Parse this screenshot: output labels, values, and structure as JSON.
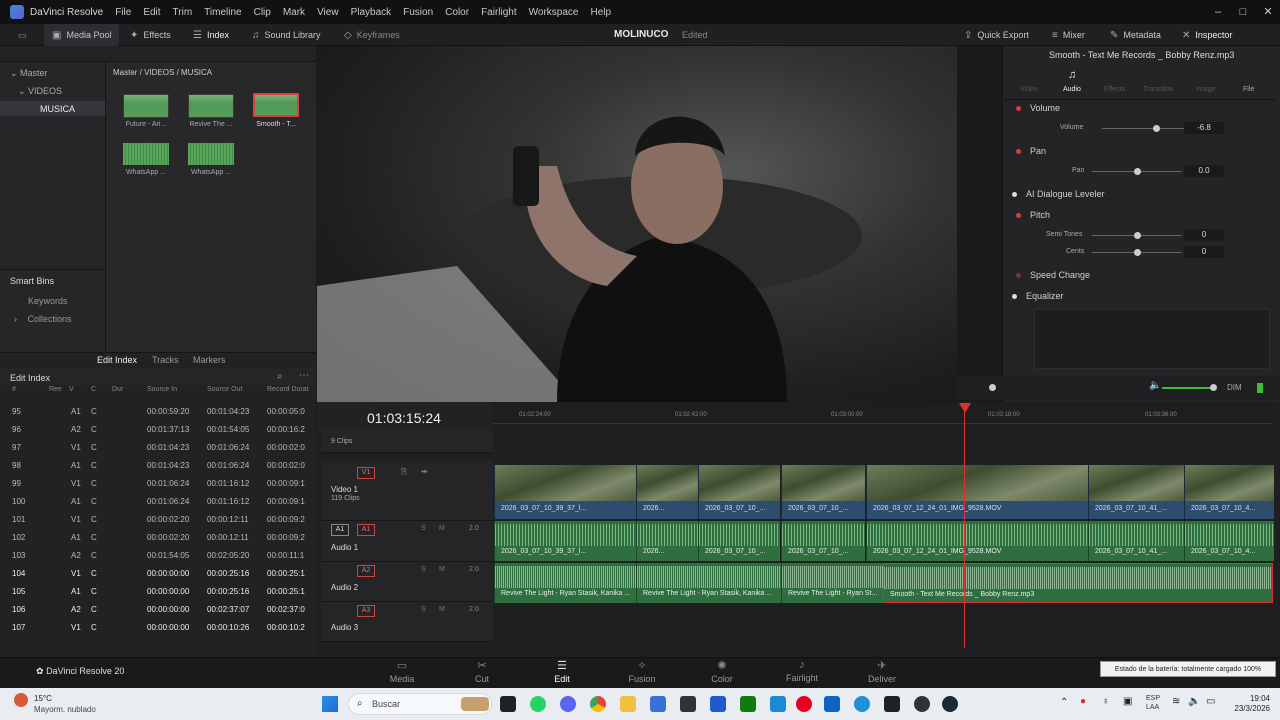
{
  "titlebar": {
    "app": "DaVinci Resolve",
    "menus": [
      "File",
      "Edit",
      "Trim",
      "Timeline",
      "Clip",
      "Mark",
      "View",
      "Playback",
      "Fusion",
      "Color",
      "Fairlight",
      "Workspace",
      "Help"
    ]
  },
  "toolbar": {
    "media_pool": "Media Pool",
    "effects": "Effects",
    "index": "Index",
    "sound_library": "Sound Library",
    "keyframes": "Keyframes",
    "project": "MOLINUCO",
    "status": "Edited",
    "quick_export": "Quick Export",
    "mixer": "Mixer",
    "metadata": "Metadata",
    "inspector": "Inspector"
  },
  "media": {
    "root": "Master",
    "videos": "VIDEOS",
    "musica": "MUSICA",
    "breadcrumb": "Master / VIDEOS / MUSICA",
    "smart_bins": "Smart Bins",
    "keywords": "Keywords",
    "collections": "Collections",
    "clips": [
      "Future - Ari...",
      "Revive The ...",
      "Smooth - T...",
      "WhatsApp ...",
      "WhatsApp ..."
    ]
  },
  "edit_index": {
    "tabs": [
      "Edit Index",
      "Tracks",
      "Markers"
    ],
    "title": "Edit Index",
    "columns": [
      "#",
      "Ree",
      "V",
      "C",
      "Dur",
      "Source In",
      "Source Out",
      "Record Durat"
    ],
    "rows": [
      [
        "95",
        "A1",
        "C",
        "00:00:59:20",
        "00:01:04:23",
        "00:00:05:0"
      ],
      [
        "96",
        "A2",
        "C",
        "00:01:37:13",
        "00:01:54:05",
        "00:00:16:2"
      ],
      [
        "97",
        "V1",
        "C",
        "00:01:04:23",
        "00:01:06:24",
        "00:00:02:0"
      ],
      [
        "98",
        "A1",
        "C",
        "00:01:04:23",
        "00:01:06:24",
        "00:00:02:0"
      ],
      [
        "99",
        "V1",
        "C",
        "00:01:06:24",
        "00:01:16:12",
        "00:00:09:1"
      ],
      [
        "100",
        "A1",
        "C",
        "00:01:06:24",
        "00:01:16:12",
        "00:00:09:1"
      ],
      [
        "101",
        "V1",
        "C",
        "00:00:02:20",
        "00:00:12:11",
        "00:00:09:2"
      ],
      [
        "102",
        "A1",
        "C",
        "00:00:02:20",
        "00:00:12:11",
        "00:00:09:2"
      ],
      [
        "103",
        "A2",
        "C",
        "00:01:54:05",
        "00:02:05:20",
        "00:00:11:1"
      ],
      [
        "104",
        "V1",
        "C",
        "00:00:00:00",
        "00:00:25:16",
        "00:00:25:1"
      ],
      [
        "105",
        "A1",
        "C",
        "00:00:00:00",
        "00:00:25:16",
        "00:00:25:1"
      ],
      [
        "106",
        "A2",
        "C",
        "00:00:00:00",
        "00:02:37:07",
        "00:02:37:0"
      ],
      [
        "107",
        "V1",
        "C",
        "00:00:00:00",
        "00:00:10:26",
        "00:00:10:2"
      ]
    ]
  },
  "inspector": {
    "file": "Smooth - Text Me Records _ Bobby Renz.mp3",
    "tabs": [
      "Video",
      "Audio",
      "Effects",
      "Transition",
      "Image",
      "File"
    ],
    "volume_section": "Volume",
    "volume_label": "Volume",
    "volume_value": "-6.8",
    "pan_section": "Pan",
    "pan_label": "Pan",
    "pan_value": "0.0",
    "ai_dialogue": "AI Dialogue Leveler",
    "pitch": "Pitch",
    "semitones_label": "Semi Tones",
    "semitones_value": "0",
    "cents_label": "Cents",
    "cents_value": "0",
    "speed_change": "Speed Change",
    "equalizer": "Equalizer",
    "dim": "DIM"
  },
  "timeline": {
    "timecode": "01:03:15:24",
    "ruler": [
      "01:02:24:00",
      "01:02:42:00",
      "01:03:00:00",
      "01:03:18:00",
      "01:03:36:00"
    ],
    "v2_count": "9 Clips",
    "v1_name": "Video 1",
    "v1_count": "119 Clips",
    "a1_name": "Audio 1",
    "a2_name": "Audio 2",
    "a3_name": "Audio 3",
    "v1_tag": "V1",
    "a1_tag": "A1",
    "a2_tag": "A2",
    "a3_tag": "A3",
    "level": "2.0",
    "video_clips": [
      "2026_03_07_10_39_37_l...",
      "2026...",
      "2026_03_07_10_...",
      "2026_03_07_10_...",
      "2026_03_07_12_24_01_IMG_9528.MOV",
      "2026_03_07_10_41_...",
      "2026_03_07_10_4..."
    ],
    "audio1_clips": [
      "2026_03_07_10_39_37_l...",
      "2026...",
      "2026_03_07_10_...",
      "2026_03_07_10_...",
      "2026_03_07_12_24_01_IMG_9528.MOV",
      "2026_03_07_10_41_...",
      "2026_03_07_10_4..."
    ],
    "audio2_clips": [
      "Revive The Light - Ryan Stasik, Kanika ...",
      "Revive The Light - Ryan Stasik, Kanika ...",
      "Revive The Light - Ryan St...",
      "Smooth - Text Me Records _ Bobby Renz.mp3"
    ]
  },
  "pages": [
    "Media",
    "Cut",
    "Edit",
    "Fusion",
    "Color",
    "Fairlight",
    "Deliver"
  ],
  "brand": "DaVinci Resolve 20",
  "tooltip": "Estado de la batería: totalmente cargado 100%",
  "taskbar": {
    "temp": "15°C",
    "weather": "Mayorm. nublado",
    "search": "Buscar",
    "lang1": "ESP",
    "lang2": "LAA",
    "time": "19:04",
    "date": "23/3/2026"
  }
}
